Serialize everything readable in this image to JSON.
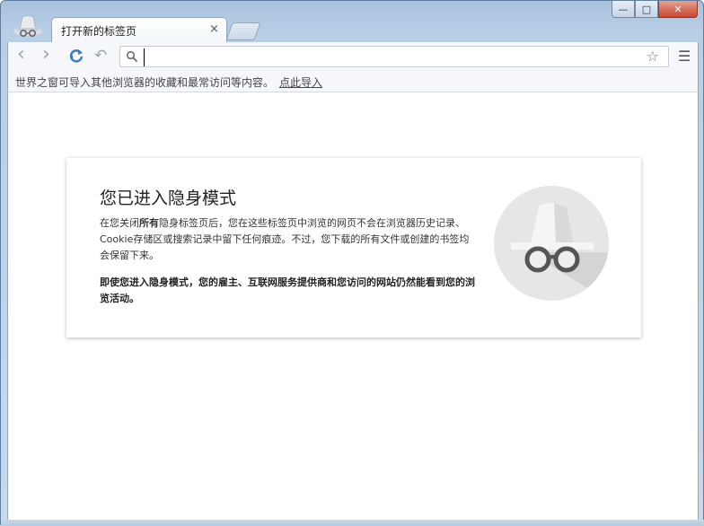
{
  "window": {
    "title_controls": {
      "minimize": "—",
      "maximize": "□",
      "close": "✕"
    }
  },
  "tab": {
    "title": "打开新的标签页",
    "close_glyph": "×"
  },
  "toolbar": {
    "back_glyph": "‹",
    "forward_glyph": "›",
    "undo_glyph": "↶",
    "omnibox_value": "",
    "star_glyph": "☆",
    "menu_glyph": "☰"
  },
  "bookmarks_bar": {
    "prompt": "世界之窗可导入其他浏览器的收藏和最常访问等内容。",
    "link": "点此导入"
  },
  "incognito": {
    "heading": "您已进入隐身模式",
    "para1_a": "在您关闭",
    "para1_bold": "所有",
    "para1_b": "隐身标签页后，您在这些标签页中浏览的网页不会在浏览器历史记录、Cookie存储区或搜索记录中留下任何痕迹。不过，您下载的所有文件或创建的书签均会保留下来。",
    "para2": "即使您进入隐身模式，您的雇主、互联网服务提供商和您访问的网站仍然能看到您的浏览活动。"
  },
  "colors": {
    "frame": "#b9cfe6",
    "reload_icon": "#3b78c6",
    "incognito_circle": "#e6e6e6",
    "incognito_glasses": "#555555"
  }
}
